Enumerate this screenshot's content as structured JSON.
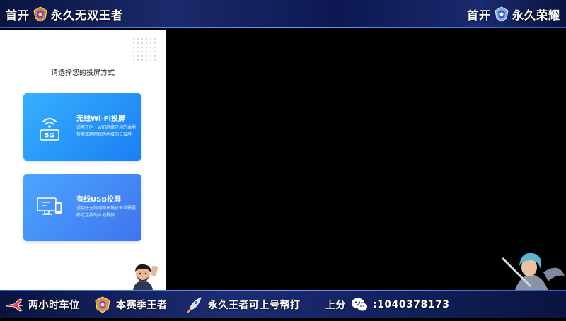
{
  "top_banner": {
    "left_prefix": "首开",
    "left_suffix": "永久无双王者",
    "right_prefix": "首开",
    "right_suffix": "永久荣耀"
  },
  "cast_panel": {
    "title": "请选择您的投屏方式",
    "options": [
      {
        "label": "无线Wi-Fi投屏",
        "description": "适用于同一WiFi网络环境的本地投屏或跨网络跨地域的云投屏",
        "icon": "wifi-5g-icon",
        "icon_text": "5G"
      },
      {
        "label": "有线USB投屏",
        "description": "适用于无线网络环境较差或需要稳定连接的本地投屏",
        "icon": "usb-monitor-icon"
      }
    ]
  },
  "bottom_banner": {
    "items": [
      {
        "text": "两小时车位",
        "icon": "jet-icon"
      },
      {
        "text": "本赛季王者",
        "icon": "king-rank-icon"
      },
      {
        "text": "永久王者可上号帮打",
        "icon": "rocket-icon"
      },
      {
        "text": "上分",
        "icon": "wechat-icon"
      },
      {
        "text": ":1040378173"
      }
    ]
  },
  "colors": {
    "banner_bg": "#0d1850",
    "card_wifi": "#1b7ef2",
    "card_usb": "#3f74ee",
    "screen_bg": "#000000"
  }
}
